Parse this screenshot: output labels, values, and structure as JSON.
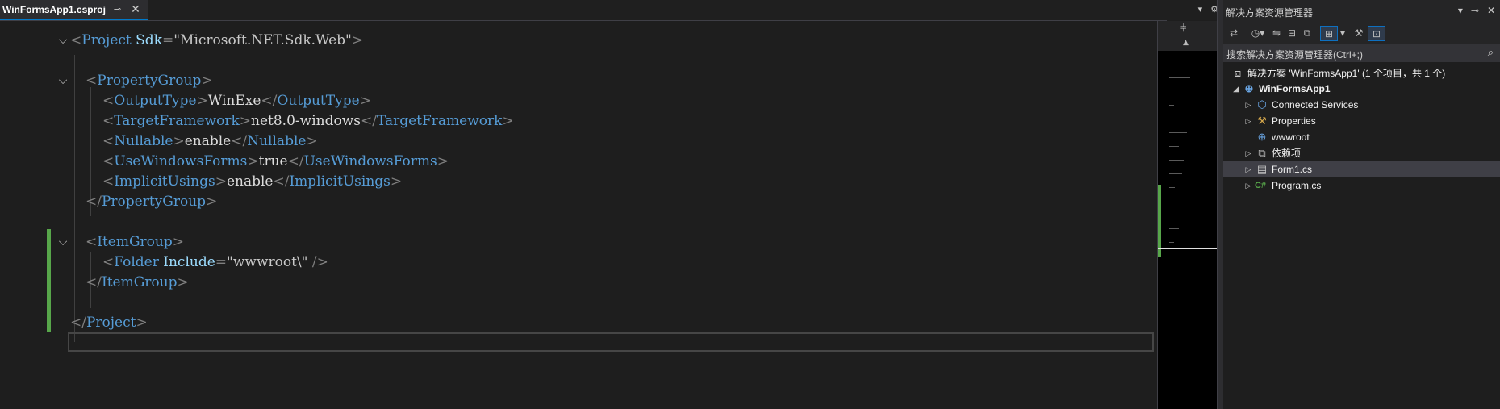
{
  "tab": {
    "title": "WinFormsApp1.csproj",
    "pin": "⊸",
    "close": "✕"
  },
  "strip_right": {
    "dropdown": "▾",
    "settings": "⚙"
  },
  "code": {
    "l1": {
      "open": "<",
      "tag": "Project",
      "attr": "Sdk",
      "eq": "=",
      "val": "\"Microsoft.NET.Sdk.Web\"",
      "close": ">"
    },
    "l3": {
      "open": "<",
      "tag": "PropertyGroup",
      "close": ">"
    },
    "l4": {
      "o1": "<",
      "tag": "OutputType",
      "c1": ">",
      "text": "WinExe",
      "o2": "</",
      "tag2": "OutputType",
      "c2": ">"
    },
    "l5": {
      "o1": "<",
      "tag": "TargetFramework",
      "c1": ">",
      "text": "net8.0-windows",
      "o2": "</",
      "tag2": "TargetFramework",
      "c2": ">"
    },
    "l6": {
      "o1": "<",
      "tag": "Nullable",
      "c1": ">",
      "text": "enable",
      "o2": "</",
      "tag2": "Nullable",
      "c2": ">"
    },
    "l7": {
      "o1": "<",
      "tag": "UseWindowsForms",
      "c1": ">",
      "text": "true",
      "o2": "</",
      "tag2": "UseWindowsForms",
      "c2": ">"
    },
    "l8": {
      "o1": "<",
      "tag": "ImplicitUsings",
      "c1": ">",
      "text": "enable",
      "o2": "</",
      "tag2": "ImplicitUsings",
      "c2": ">"
    },
    "l9": {
      "open": "</",
      "tag": "PropertyGroup",
      "close": ">"
    },
    "l11": {
      "open": "<",
      "tag": "ItemGroup",
      "close": ">"
    },
    "l12": {
      "open": "<",
      "tag": "Folder",
      "attr": "Include",
      "eq": "=",
      "val": "\"wwwroot\\\"",
      "close": " />"
    },
    "l13": {
      "open": "</",
      "tag": "ItemGroup",
      "close": ">"
    },
    "l15": {
      "open": "</",
      "tag": "Project",
      "close": ">"
    },
    "fold_glyph": "⌵"
  },
  "minimap": {
    "split": "⫩",
    "up": "▲"
  },
  "explorer": {
    "title": "解决方案资源管理器",
    "title_icons": {
      "dropdown": "▾",
      "pin": "⊸",
      "close": "✕"
    },
    "toolbar_icons": [
      "switch-views",
      "history",
      "sync",
      "collapse",
      "copy",
      "show-all",
      "dropdown",
      "properties",
      "preview"
    ],
    "search_placeholder": "搜索解决方案资源管理器(Ctrl+;)",
    "search_icon": "⌕",
    "nodes": {
      "solution": "解决方案 'WinFormsApp1' (1 个项目，共 1 个)",
      "project": "WinFormsApp1",
      "connected": "Connected Services",
      "properties": "Properties",
      "wwwroot": "wwwroot",
      "deps": "依赖项",
      "form1": "Form1.cs",
      "program": "Program.cs"
    }
  },
  "colors": {
    "accent": "#007acc",
    "change_bar": "#57a64a",
    "tag": "#569cd6",
    "attr": "#9cdcfe"
  }
}
